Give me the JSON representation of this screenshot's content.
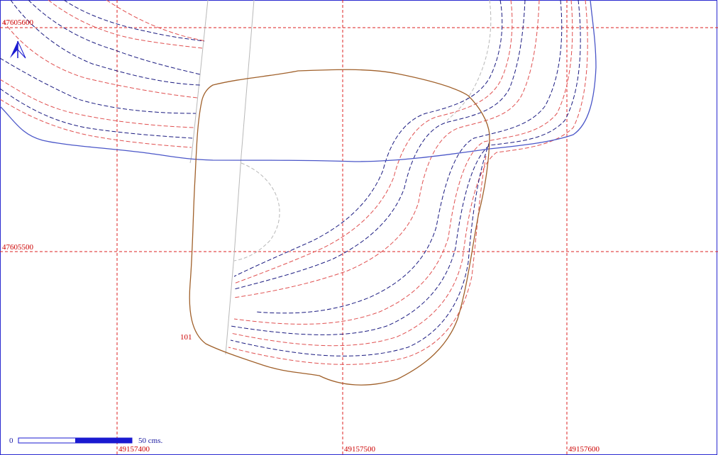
{
  "map": {
    "grid": {
      "x_labels": [
        "49157400",
        "49157500",
        "49157600"
      ],
      "y_labels": [
        "47605600",
        "47605500"
      ],
      "color": "#dd2222"
    },
    "parcel_label": "101",
    "scale_bar": {
      "start_label": "0",
      "end_label": "50 cms."
    },
    "north_arrow": "north-arrow-icon",
    "colors": {
      "frame": "#2a2ad0",
      "contour_blue": "#1a1a80",
      "contour_red": "#e05050",
      "boundary_blue": "#4a56c8",
      "parcel": "#a0602a",
      "path_gray": "#b8b8b8",
      "grid": "#dd2222"
    }
  }
}
